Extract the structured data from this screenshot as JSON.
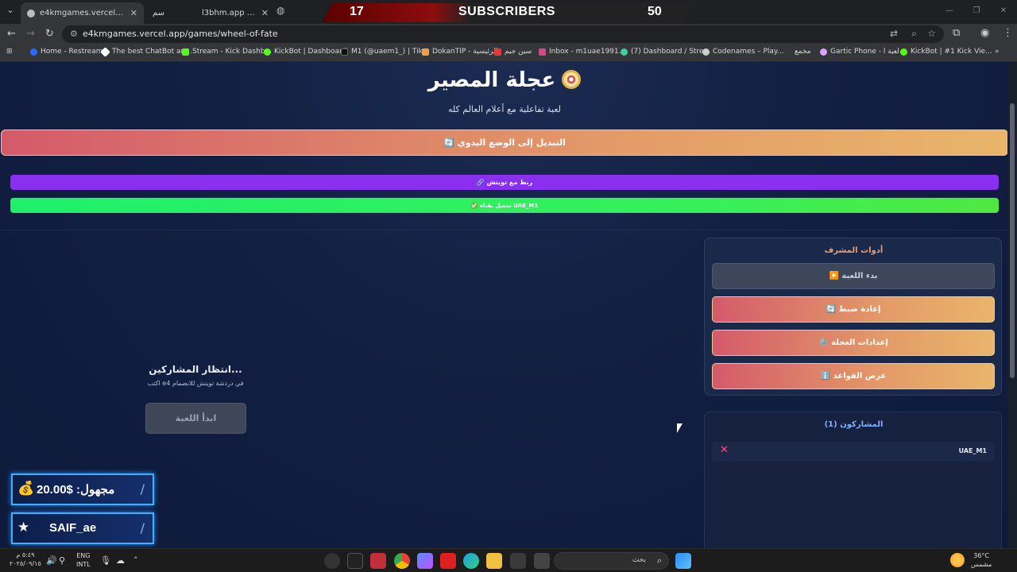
{
  "browser": {
    "tabs": [
      {
        "title": "e4kmgames.vercel.app/games/"
      },
      {
        "title": "سم"
      },
      {
        "title": "l3bhm.app | لعبهم"
      }
    ],
    "url": "e4kmgames.vercel.app/games/wheel-of-fate",
    "bookmarks": [
      "Home - Restream",
      "The best ChatBot an...",
      "Stream - Kick Dashb...",
      "KickBot | Dashboard",
      "M1 (@uaem1_) | Tik...",
      "DokanTIP - الرئيسية",
      "سين جيم",
      "Inbox - m1uae1991...",
      "(7) Dashboard / Stre...",
      "Codenames – Play...",
      "مخمع",
      "Gartic Phone - لعبة ا...",
      "KickBot | #1 Kick Vie..."
    ]
  },
  "stream_overlay": {
    "sub_count": "17",
    "sub_label": "SUBSCRIBERS",
    "sub_goal": "50",
    "donation": "مجهول: $20.00",
    "follower": "SAIF_ae"
  },
  "game": {
    "title": "عجلة المصير",
    "subtitle": "لعبة تفاعلية مع أعلام العالم كله",
    "manual_mode_label": "🔄 التبديل إلى الوضع اليدوي",
    "twitch_link_label": "🔗 ربط مع تويتش",
    "connected_label": "✅ متصل بقناة UAE_M1",
    "waiting_title": "انتظار المشاركين...",
    "waiting_hint": "اكتب e4 في دردشة تويتش للانضمام",
    "start_label": "ابدأ اللعبة"
  },
  "admin": {
    "title": "أدوات المشرف",
    "buttons": [
      {
        "label": "▶️ بدء اللعبة"
      },
      {
        "label": "🔄 إعادة ضبط"
      },
      {
        "label": "⚙️ إعدادات العجلة"
      },
      {
        "label": "ℹ️ عرض القواعد"
      }
    ]
  },
  "participants": {
    "title": "المشاركون (1)",
    "list": [
      {
        "name": "UAE_M1"
      }
    ]
  },
  "taskbar": {
    "time": "٥:٤٩ م",
    "date": "٢٠٢٥/٠٩/١٥",
    "lang_top": "ENG",
    "lang_bottom": "INTL",
    "search_label": "بحث",
    "temp": "36°C",
    "weather": "مشمس"
  }
}
